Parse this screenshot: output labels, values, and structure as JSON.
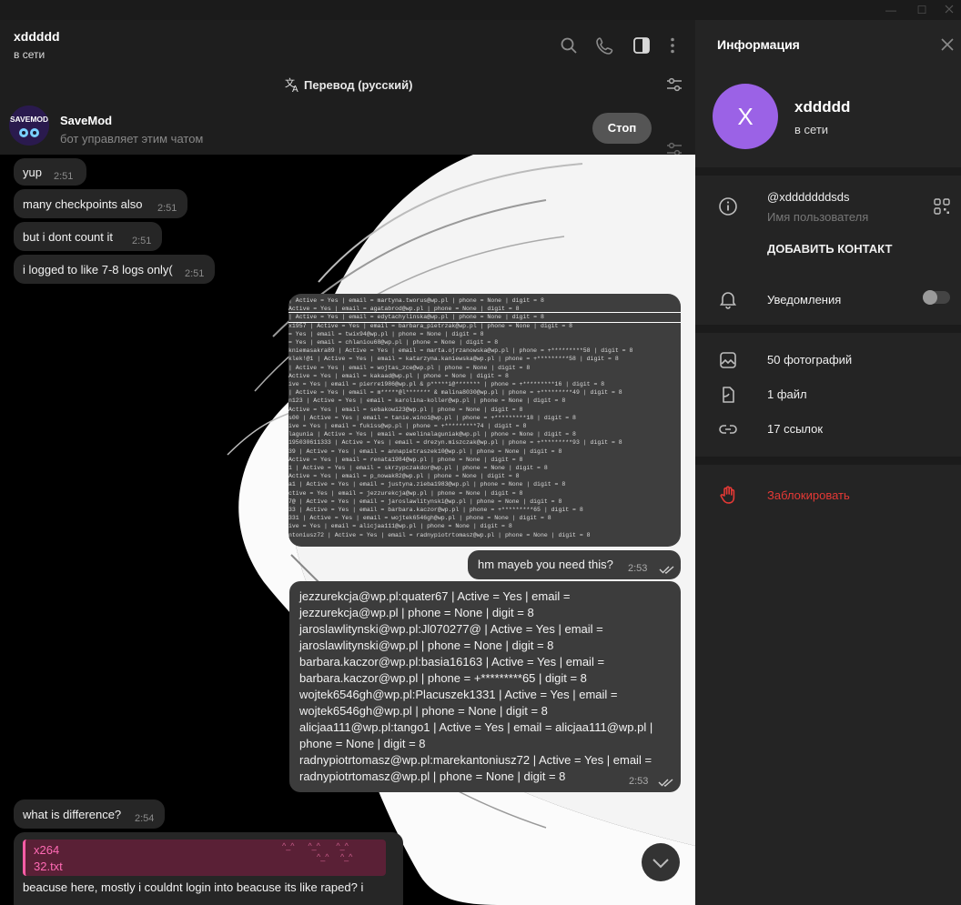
{
  "window": {
    "minimize": "—",
    "maximize": "☐"
  },
  "chat_header": {
    "title": "xddddd",
    "status": "в сети"
  },
  "translate_bar": {
    "label": "Перевод (русский)"
  },
  "bot_bar": {
    "name": "SaveMod",
    "description": "бот управляет этим чатом",
    "stop_label": "Стоп",
    "avatar_text": "SAVEMOD"
  },
  "messages": [
    {
      "text": "yup",
      "time": "2:51"
    },
    {
      "text": "many checkpoints also",
      "time": "2:51"
    },
    {
      "text": "but i dont count it",
      "time": "2:51"
    },
    {
      "text": "i logged to like 7-8 logs only(",
      "time": "2:51"
    },
    {
      "text": "hm mayeb you need this?",
      "time": "2:53"
    },
    {
      "lines": [
        "jezzurekcja@wp.pl:quater67 | Active = Yes | email =",
        "jezzurekcja@wp.pl | phone = None | digit = 8",
        "jaroslawlitynski@wp.pl:Jl070277@ | Active = Yes | email =",
        "jaroslawlitynski@wp.pl | phone = None | digit = 8",
        "barbara.kaczor@wp.pl:basia16163 | Active = Yes | email =",
        "barbara.kaczor@wp.pl | phone = +*********65 | digit = 8",
        "wojtek6546gh@wp.pl:Placuszek1331 | Active = Yes | email =",
        "wojtek6546gh@wp.pl | phone = None | digit = 8",
        "alicjaa111@wp.pl:tango1 | Active = Yes | email = alicjaa111@wp.pl |",
        "phone = None | digit = 8",
        "radnypiotrtomasz@wp.pl:marekantoniusz72 | Active = Yes | email =",
        "radnypiotrtomasz@wp.pl | phone = None | digit = 8"
      ],
      "time": "2:53"
    },
    {
      "text": "what is difference?",
      "time": "2:54"
    },
    {
      "quote_author": "x264",
      "quote_file": "32.txt",
      "text": "beacuse here, mostly i couldnt login into beacuse its like raped? i"
    }
  ],
  "screenshot_lines": [
    "| Active = Yes | email = martyna.tworus@wp.pl | phone = None | digit = 8",
    "Active = Yes | email = agatabrod@wp.pl | phone = None | digit = 8",
    "| Active = Yes | email = edytachylinska@wp.pl | phone = None | digit = 8",
    "x1957 | Active = Yes | email = barbara_pietrzak@wp.pl | phone = None | digit = 8",
    "= Yes | email = twix94@wp.pl | phone = None | digit = 8",
    "= Yes | email = chlaniou68@wp.pl | phone = None | digit = 8",
    "kniemasakra89 | Active = Yes | email = marta.ojrzanowska@wp.pl | phone = +*********58 | digit = 8",
    "klek!@1 | Active = Yes | email = katarzyna.kaniewska@wp.pl | phone = +*********58 | digit = 8",
    "| Active = Yes | email = wojtas_zce@wp.pl | phone = None | digit = 8",
    "Active = Yes | email = kakaad@wp.pl | phone = None | digit = 8",
    "ive = Yes | email = pierre1986@wp.pl & p*****i@******* | phone = +*********16 | digit = 8",
    "| Active = Yes | email = m*****@l******* & malina8030@wp.pl | phone = +*********49 | digit = 8",
    "n123 | Active = Yes | email = karolina-koller@wp.pl | phone = None | digit = 8",
    "Active = Yes | email = sebakow123@wp.pl | phone = None | digit = 8",
    "s00 | Active = Yes | email = tanie.wino1@wp.pl | phone = +*********18 | digit = 8",
    "ive = Yes | email = fukiss@wp.pl | phone = +*********74 | digit = 8",
    "lagunia | Active = Yes | email = ewelinalaguniak@wp.pl | phone = None | digit = 8",
    "195030611333 | Active = Yes | email = drezyn.miszczak@wp.pl | phone = +*********93 | digit = 8",
    "39 | Active = Yes | email = annapietraszek10@wp.pl | phone = None | digit = 8",
    "Active = Yes | email = renata1984@wp.pl | phone = None | digit = 8",
    "1 | Active = Yes | email = skrzypczakdor@wp.pl | phone = None | digit = 8",
    "Active = Yes | email = p_nowak82@wp.pl | phone = None | digit = 8",
    "a1 | Active = Yes | email = justyna.zieba1983@wp.pl | phone = None | digit = 8",
    "ctive = Yes | email = jezzurekcja@wp.pl | phone = None | digit = 8",
    "7@ | Active = Yes | email = jaroslawlitynski@wp.pl | phone = None | digit = 8",
    "33 | Active = Yes | email = barbara.kaczor@wp.pl | phone = +*********65 | digit = 8",
    "331 | Active = Yes | email = wojtek6546gh@wp.pl | phone = None | digit = 8",
    "ive = Yes | email = alicjaa111@wp.pl | phone = None | digit = 8",
    "ntoniusz72 | Active = Yes | email = radnypiotrtomasz@wp.pl | phone = None | digit = 8"
  ],
  "info": {
    "title": "Информация",
    "avatar_letter": "X",
    "name": "xddddd",
    "status": "в сети",
    "username": "@xdddddddsds",
    "username_label": "Имя пользователя",
    "add_contact": "ДОБАВИТЬ КОНТАКТ",
    "notifications": "Уведомления",
    "notifications_on": false,
    "photos": "50 фотографий",
    "files": "1 файл",
    "links": "17 ссылок",
    "block": "Заблокировать"
  },
  "colors": {
    "accent_purple": "#9b62e6",
    "danger": "#e53935",
    "quote_pink": "#ff6ab4"
  }
}
